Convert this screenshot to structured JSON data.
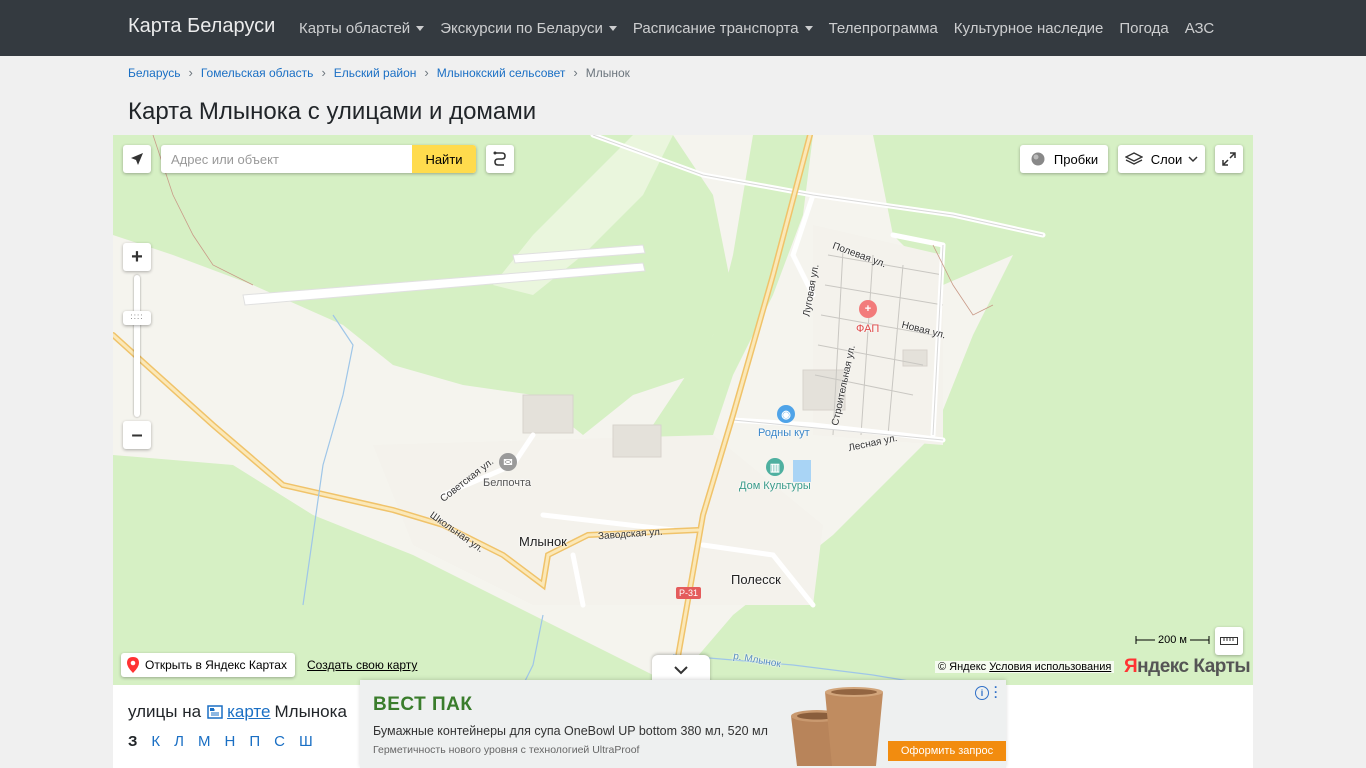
{
  "navbar": {
    "brand": "Карта Беларуси",
    "items": [
      {
        "label": "Карты областей",
        "dropdown": true
      },
      {
        "label": "Экскурсии по Беларуси",
        "dropdown": true
      },
      {
        "label": "Расписание транспорта",
        "dropdown": true
      },
      {
        "label": "Телепрограмма",
        "dropdown": false
      },
      {
        "label": "Культурное наследие",
        "dropdown": false
      },
      {
        "label": "Погода",
        "dropdown": false
      },
      {
        "label": "АЗС",
        "dropdown": false
      }
    ]
  },
  "breadcrumb": [
    "Беларусь",
    "Гомельская область",
    "Ельский район",
    "Млынокский сельсовет",
    "Млынок"
  ],
  "page_title": "Карта Млынока с улицами и домами",
  "map": {
    "search_placeholder": "Адрес или объект",
    "search_button": "Найти",
    "traffic_label": "Пробки",
    "layers_label": "Слои",
    "places": {
      "mlynok": "Млынок",
      "polessk": "Полесск"
    },
    "streets": {
      "sovetskaya": "Советская ул.",
      "shkolnaya": "Школьная ул.",
      "zavodskaya": "Заводская ул.",
      "polevaya": "Полевая ул.",
      "lugovaya": "Луговая ул.",
      "novaya": "Новая ул.",
      "stroitelnaya": "Строительная ул.",
      "lesnaya": "Лесная ул.",
      "river": "р. Млынок"
    },
    "poi": {
      "fap": "ФАП",
      "rodny_kut": "Родны кут",
      "belpochta": "Белпочта",
      "dom_kultury": "Дом Культуры"
    },
    "road_badge": "Р-31",
    "scale_label": "200 м",
    "open_in_yandex": "Открыть в Яндекс Картах",
    "create_map": "Создать свою карту",
    "copyright": "© Яндекс",
    "terms": "Условия использования",
    "logo_first": "Я",
    "logo_rest": "ндекс Карты"
  },
  "streets_section": {
    "prefix": "улицы на",
    "link": "карте",
    "suffix": "Млынока",
    "letters": [
      "З",
      "К",
      "Л",
      "М",
      "Н",
      "П",
      "С",
      "Ш"
    ]
  },
  "ad": {
    "brand": "ВЕСТ ПАК",
    "headline": "Бумажные контейнеры для супа OneBowl UP bottom 380 мл, 520 мл",
    "subline": "Герметичность нового уровня с технологией UltraProof",
    "cta": "Оформить запрос"
  },
  "colors": {
    "navbar_bg": "#343a40",
    "map_green": "#d6f0c4",
    "road_yellow": "#f5d98a",
    "link": "#1a6fc4",
    "search_button": "#ffdb4d",
    "ad_cta": "#f28c0f"
  }
}
